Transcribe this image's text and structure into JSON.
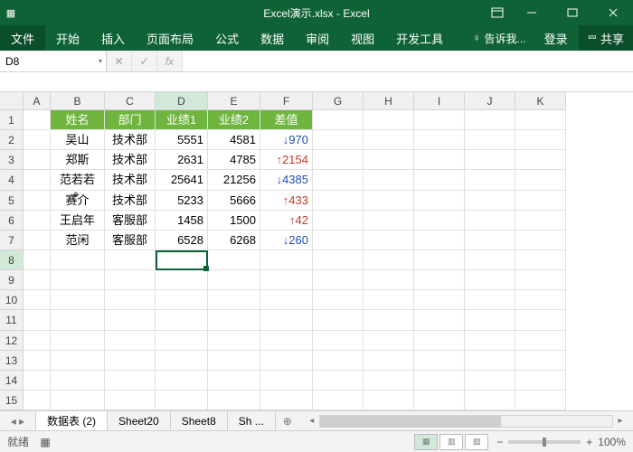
{
  "title": "Excel演示.xlsx - Excel",
  "ribbon": {
    "file": "文件",
    "tabs": [
      "开始",
      "插入",
      "页面布局",
      "公式",
      "数据",
      "审阅",
      "视图",
      "开发工具"
    ],
    "tell": "告诉我...",
    "login": "登录",
    "share": "共享"
  },
  "namebox": "D8",
  "fx_label": "fx",
  "columns": [
    "A",
    "B",
    "C",
    "D",
    "E",
    "F",
    "G",
    "H",
    "I",
    "J",
    "K"
  ],
  "headers": {
    "b": "姓名",
    "c": "部门",
    "d": "业绩1",
    "e": "业绩2",
    "f": "差值"
  },
  "rows": [
    {
      "b": "吴山",
      "c": "技术部",
      "d": "5551",
      "e": "4581",
      "f": "↓970",
      "dir": "down"
    },
    {
      "b": "郑斯",
      "c": "技术部",
      "d": "2631",
      "e": "4785",
      "f": "↑2154",
      "dir": "up"
    },
    {
      "b": "范若若",
      "c": "技术部",
      "d": "25641",
      "e": "21256",
      "f": "↓4385",
      "dir": "down"
    },
    {
      "b": "赛介",
      "c": "技术部",
      "d": "5233",
      "e": "5666",
      "f": "↑433",
      "dir": "up"
    },
    {
      "b": "王启年",
      "c": "客服部",
      "d": "1458",
      "e": "1500",
      "f": "↑42",
      "dir": "up"
    },
    {
      "b": "范闲",
      "c": "客服部",
      "d": "6528",
      "e": "6268",
      "f": "↓260",
      "dir": "down"
    }
  ],
  "active_cell": "D8",
  "sheets": {
    "list": [
      "数据表 (2)",
      "Sheet20",
      "Sheet8",
      "Sh ..."
    ],
    "active": 0,
    "add": "⊕"
  },
  "status": {
    "ready": "就绪",
    "zoom": "100%",
    "minus": "−",
    "plus": "+"
  },
  "cursor_glyph": "⌖"
}
